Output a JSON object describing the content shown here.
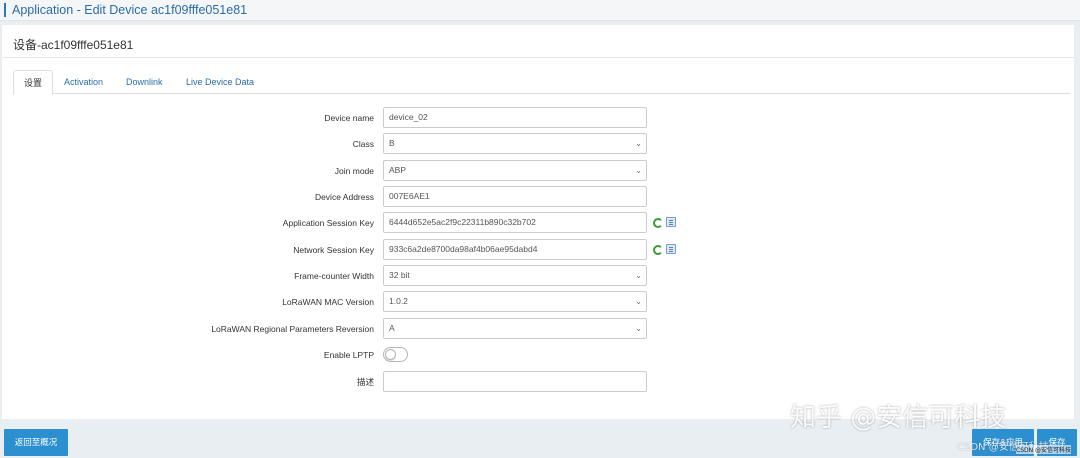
{
  "header": {
    "title": "Application - Edit Device ac1f09fffe051e81"
  },
  "panel": {
    "device_title": "设备-ac1f09fffe051e81"
  },
  "tabs": [
    {
      "label": "设置",
      "active": true
    },
    {
      "label": "Activation",
      "active": false
    },
    {
      "label": "Downlink",
      "active": false
    },
    {
      "label": "Live Device Data",
      "active": false
    }
  ],
  "form": {
    "device_name": {
      "label": "Device name",
      "value": "device_02"
    },
    "class": {
      "label": "Class",
      "value": "B"
    },
    "join_mode": {
      "label": "Join mode",
      "value": "ABP"
    },
    "device_address": {
      "label": "Device Address",
      "value": "007E6AE1"
    },
    "app_session_key": {
      "label": "Application Session Key",
      "value": "6444d652e5ac2f9c22311b890c32b702"
    },
    "network_session_key": {
      "label": "Network Session Key",
      "value": "933c6a2de8700da98af4b06ae95dabd4"
    },
    "frame_counter_width": {
      "label": "Frame-counter Width",
      "value": "32 bit"
    },
    "mac_version": {
      "label": "LoRaWAN MAC Version",
      "value": "1.0.2"
    },
    "regional_params": {
      "label": "LoRaWAN Regional Parameters Reversion",
      "value": "A"
    },
    "enable_lptp": {
      "label": "Enable LPTP",
      "enabled": false
    },
    "description": {
      "label": "描述",
      "value": ""
    }
  },
  "buttons": {
    "back": "返回至概况",
    "save_apply": "保存&应用",
    "save": "保存"
  },
  "watermarks": {
    "zhihu": "知乎 @安信可科技",
    "csdn": "CSDN @安信可科技",
    "csdn_small": "CSDN @安信可科技"
  },
  "icons": {
    "refresh": "refresh-icon",
    "copy": "copy-icon",
    "dropdown": "chevron-down-icon"
  },
  "colors": {
    "accent": "#2c8fd0",
    "link": "#2a6ca8",
    "background": "#e9eef3"
  }
}
